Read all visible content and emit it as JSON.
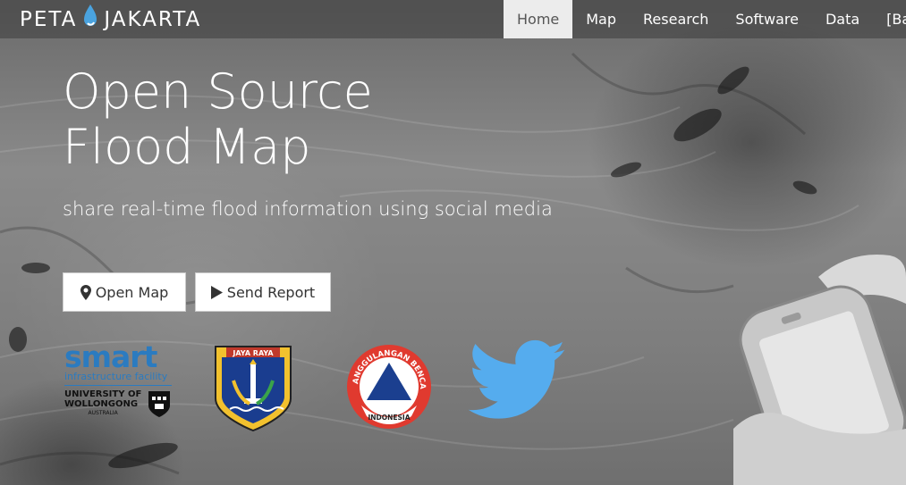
{
  "brand": {
    "left": "PETA",
    "right": "JAKARTA",
    "drop_color": "#4aa3df"
  },
  "nav": {
    "items": [
      {
        "label": "Home",
        "active": true
      },
      {
        "label": "Map",
        "active": false
      },
      {
        "label": "Research",
        "active": false
      },
      {
        "label": "Software",
        "active": false
      },
      {
        "label": "Data",
        "active": false
      },
      {
        "label": "[Ba",
        "active": false
      }
    ]
  },
  "hero": {
    "title_line1": "Open Source",
    "title_line2": "Flood Map",
    "subtitle": "share real-time flood information using social media"
  },
  "buttons": {
    "open_map": {
      "label": "Open Map",
      "icon": "map-marker-icon"
    },
    "send_report": {
      "label": "Send Report",
      "icon": "play-icon"
    }
  },
  "logos": {
    "smart": {
      "word": "smart",
      "sub": "infrastructure facility",
      "uni_line1": "UNIVERSITY OF",
      "uni_line2": "WOLLONGONG",
      "uni_line3": "AUSTRALIA",
      "color": "#2b7bc0"
    },
    "jaya": {
      "banner": "JAYA RAYA"
    },
    "bnpb": {
      "ring_text": "PENANGGULANGAN BENCANA",
      "bottom_text": "INDONESIA"
    },
    "twitter": {
      "color": "#55acee"
    }
  }
}
